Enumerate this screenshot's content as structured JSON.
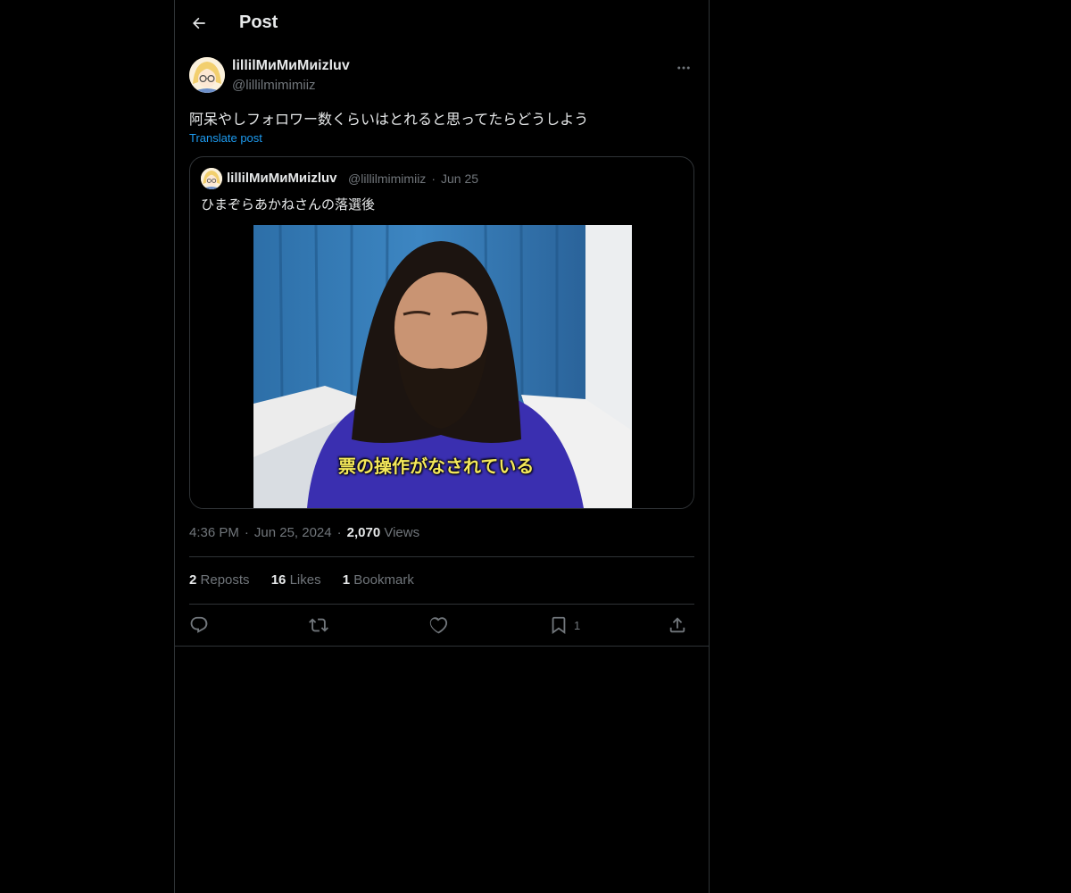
{
  "header": {
    "title": "Post"
  },
  "post": {
    "display_name": "lillilMиMиMиizluv",
    "handle": "@lillilmimimiiz",
    "text": "阿呆やしフォロワー数くらいはとれると思ってたらどうしよう",
    "translate_label": "Translate post",
    "time": "4:36 PM",
    "date": "Jun 25, 2024",
    "views_count": "2,070",
    "views_label": "Views"
  },
  "quote": {
    "display_name": "lillilMиMиMиizluv",
    "handle": "@lillilmimimiiz",
    "dot": "·",
    "date": "Jun 25",
    "text": "ひまぞらあかねさんの落選後",
    "media_caption": "票の操作がなされている"
  },
  "stats": {
    "reposts_count": "2",
    "reposts_label": "Reposts",
    "likes_count": "16",
    "likes_label": "Likes",
    "bookmarks_count": "1",
    "bookmarks_label": "Bookmark"
  },
  "actions": {
    "bookmark_count": "1"
  },
  "icons": [
    "back-arrow-icon",
    "more-icon",
    "reply-icon",
    "repost-icon",
    "like-icon",
    "bookmark-icon",
    "share-icon"
  ],
  "colors": {
    "background": "#000000",
    "text": "#e7e9ea",
    "muted": "#71767b",
    "link": "#1d9bf0",
    "border": "#2f3336"
  }
}
